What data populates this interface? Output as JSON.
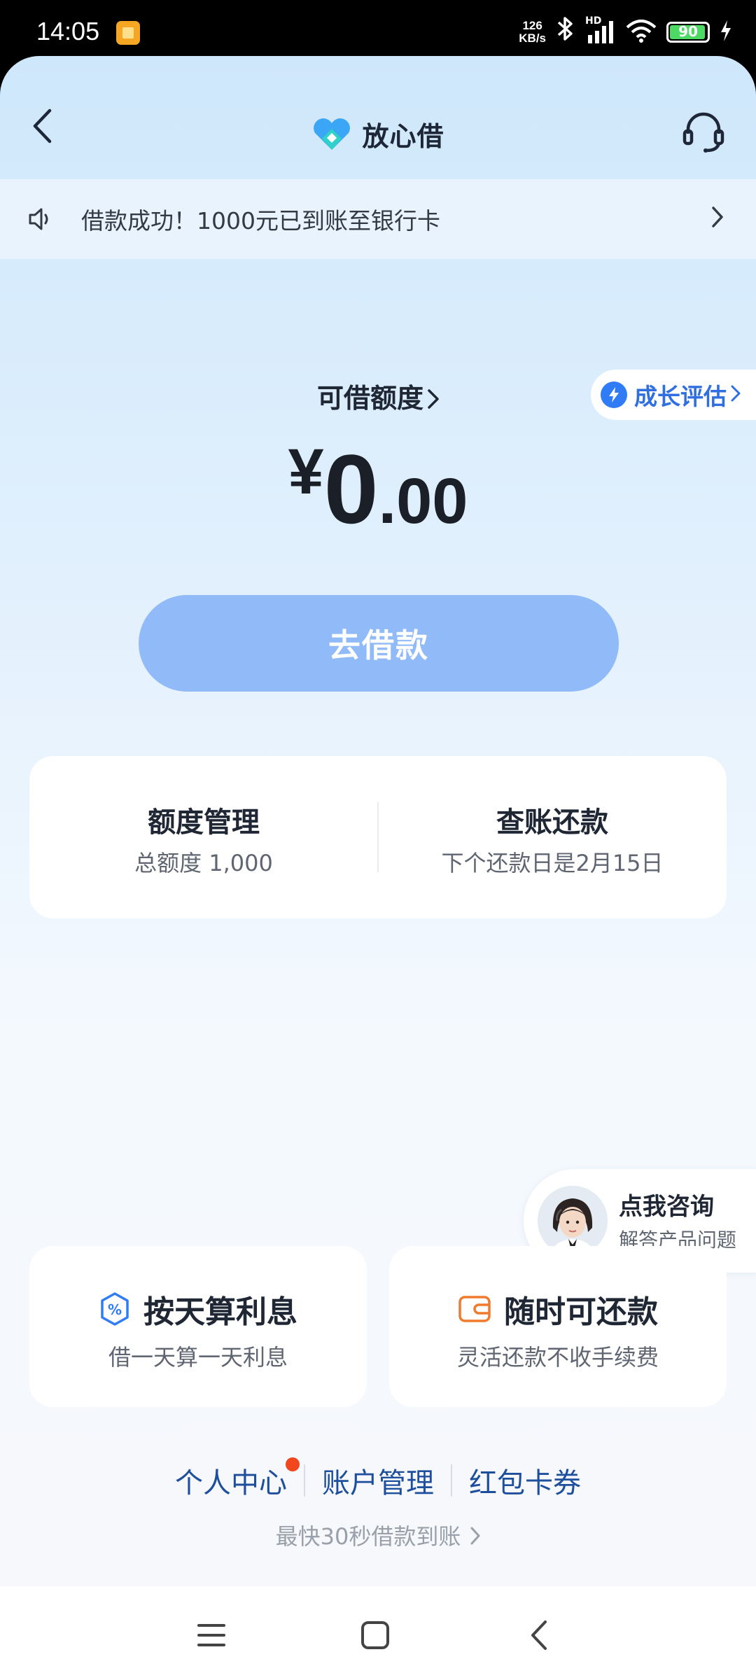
{
  "status_bar": {
    "time": "14:05",
    "net_speed_value": "126",
    "net_speed_unit": "KB/s",
    "signal_label": "HD",
    "battery": "90"
  },
  "header": {
    "title": "放心借",
    "back_icon": "chevron-left-icon",
    "support_icon": "headset-icon"
  },
  "notice": {
    "text": "借款成功！1000元已到账至银行卡",
    "icon": "speaker-icon"
  },
  "growth_badge": {
    "label": "成长评估"
  },
  "credit": {
    "label": "可借额度",
    "currency": "¥",
    "amount_int": "0",
    "amount_dec": ".00"
  },
  "borrow_button": {
    "label": "去借款"
  },
  "cards": {
    "limit_manage": {
      "title": "额度管理",
      "sub": "总额度 1,000"
    },
    "repay": {
      "title": "查账还款",
      "sub": "下个还款日是2月15日"
    }
  },
  "consult": {
    "title": "点我咨询",
    "sub": "解答产品问题"
  },
  "features": [
    {
      "title": "按天算利息",
      "sub": "借一天算一天利息",
      "icon": "percent-icon"
    },
    {
      "title": "随时可还款",
      "sub": "灵活还款不收手续费",
      "icon": "wallet-icon"
    }
  ],
  "links": [
    "个人中心",
    "账户管理",
    "红包卡券"
  ],
  "footer_note": "最快30秒借款到账",
  "colors": {
    "accent": "#2f6fe0",
    "button": "#90baf8",
    "link": "#1e4f9c",
    "badge": "#f2461e"
  }
}
